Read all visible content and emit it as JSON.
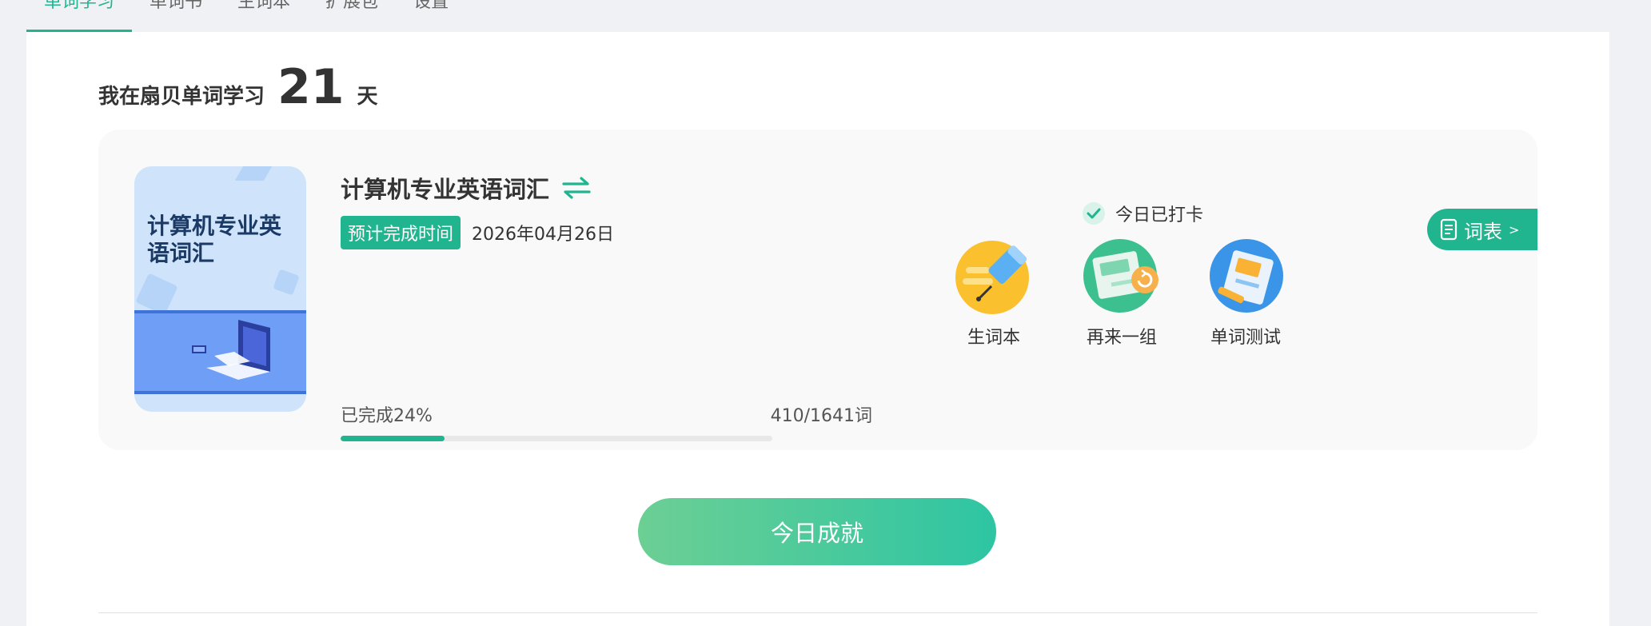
{
  "tabs": [
    {
      "label": "单词学习",
      "active": true
    },
    {
      "label": "单词书",
      "active": false
    },
    {
      "label": "生词本",
      "active": false
    },
    {
      "label": "扩展包",
      "active": false
    },
    {
      "label": "设置",
      "active": false
    }
  ],
  "headline": {
    "prefix": "我在扇贝单词学习",
    "days": "21",
    "suffix": "天"
  },
  "book": {
    "cover_title": "计算机专业英语词汇",
    "title": "计算机专业英语词汇",
    "eta_tag": "预计完成时间",
    "eta_date": "2026年04月26日",
    "progress_label": "已完成24%",
    "progress_count": "410/1641词",
    "progress_fraction": 0.24
  },
  "checkin": {
    "text": "今日已打卡"
  },
  "wordlist_button": {
    "label": "词表",
    "arrow": ">"
  },
  "actions": [
    {
      "label": "生词本",
      "icon": "highlighter-icon"
    },
    {
      "label": "再来一组",
      "icon": "refresh-cards-icon"
    },
    {
      "label": "单词测试",
      "icon": "test-paper-icon"
    }
  ],
  "cta": {
    "label": "今日成就"
  },
  "colors": {
    "accent": "#21b58f",
    "cta_start": "#6ccf94",
    "cta_end": "#2ec5a3",
    "card_bg": "#f9f9f9",
    "page_bg": "#f0f1f4"
  }
}
